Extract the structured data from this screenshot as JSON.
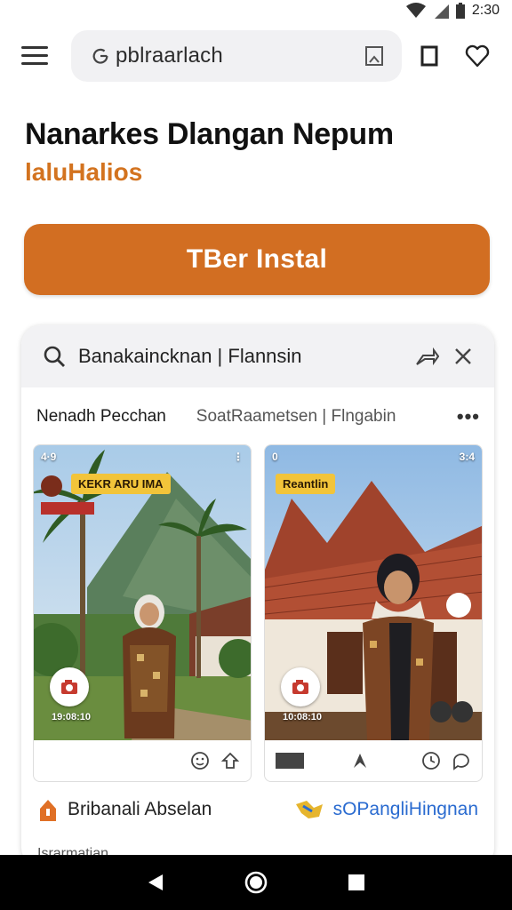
{
  "status_bar": {
    "time": "2:30"
  },
  "toolbar": {
    "url": "pblraarlach"
  },
  "header": {
    "title": "Nanarkes Dlangan Nepum",
    "subtitle": "laluHalios",
    "install_label": "TBer  Instal"
  },
  "card": {
    "search_query": "Banakaincknan | Flannsin",
    "tabs": [
      "Nenadh Pecchan",
      "SoatRaametsen | Flngabin"
    ],
    "posts": [
      {
        "status": "4·9",
        "badge": "KEKR ARU IMA",
        "time": "19:08:10"
      },
      {
        "status": "0",
        "status_right": "3:4",
        "badge": "Reantlin",
        "time": "10:08:10"
      }
    ],
    "footer_left": "Bribanali Abselan",
    "footer_right": "sOPangliHingnan",
    "footer_cut": "Israrmatian"
  },
  "colors": {
    "accent": "#d26e22",
    "subtitle": "#d3731f",
    "link": "#2a6bd0",
    "badge": "#f2c43a"
  }
}
